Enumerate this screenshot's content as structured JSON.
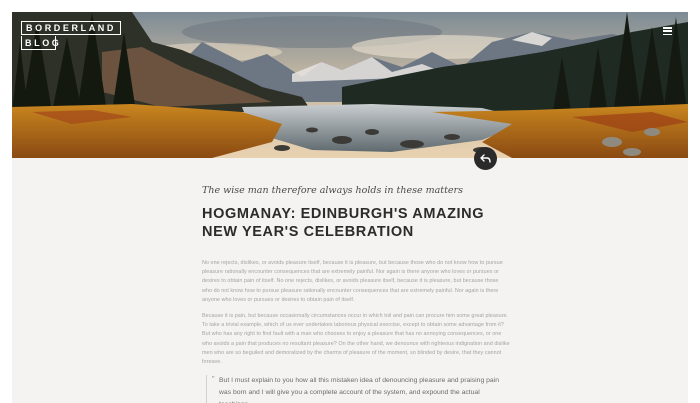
{
  "brand": {
    "line1": "BORDERLAND",
    "line2": "BLOG"
  },
  "header": {
    "menu_icon": "hamburger-icon",
    "back_icon": "back-arrow-icon"
  },
  "article": {
    "subtitle": "The wise man therefore always holds in these matters",
    "title": "HOGMANAY: EDINBURGH'S AMAZING NEW YEAR'S CELEBRATION",
    "paragraphs": [
      "No one rejects, dislikes, or avoids pleasure itself, because it is pleasure, but because those who do not know how to pursue pleasure rationally encounter consequences that are extremely painful. Nor again is there anyone who loves or pursues or desires to obtain pain of itself. No one rejects, dislikes, or avoids pleasure itself, because it is pleasure, but because those who do not know how to pursue pleasure rationally encounter consequences that are extremely painful. Nor again is there anyone who loves or pursues or desires to obtain pain of itself.",
      "Because it is pain, but because occasionally circumstances occur in which toil and pain can procure him some great pleasure. To take a trivial example, which of us ever undertakes laborious physical exercise, except to obtain some advantage from it? But who has any right to find fault with a man who chooses to enjoy a pleasure that has no annoying consequences, or one who avoids a pain that produces no resultant pleasure? On the other hand, we denounce with righteous indignation and dislike men who are so beguiled and demoralized by the charms of pleasure of the moment, so blinded by desire, that they cannot foresee."
    ],
    "quote_mark": "\"",
    "quote": "But I must explain to you how all this mistaken idea of denouncing pleasure and praising pain was born and I will give you a complete account of the system, and expound the actual teachings"
  },
  "colors": {
    "page_bg": "#f4f3f1",
    "title": "#2b2b2b",
    "body_text": "#a3a3a3",
    "button": "#2a2a2a"
  }
}
